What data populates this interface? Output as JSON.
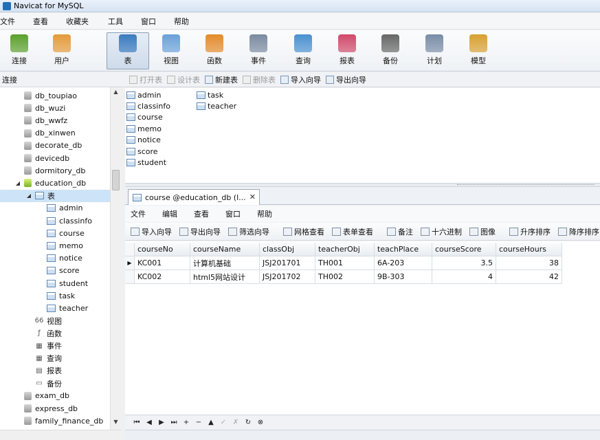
{
  "window": {
    "title": "Navicat for MySQL"
  },
  "menu": [
    "文件",
    "查看",
    "收藏夹",
    "工具",
    "窗口",
    "帮助"
  ],
  "toolbar": [
    {
      "label": "连接",
      "icon": "connection-icon",
      "color": "#5aa02c"
    },
    {
      "label": "用户",
      "icon": "user-icon",
      "color": "#e49a3a"
    },
    {
      "label": "表",
      "icon": "table-icon",
      "color": "#3b7bbf",
      "active": true
    },
    {
      "label": "视图",
      "icon": "view-icon",
      "color": "#6aa0d8"
    },
    {
      "label": "函数",
      "icon": "function-icon",
      "color": "#e48a2a"
    },
    {
      "label": "事件",
      "icon": "event-icon",
      "color": "#7a8aa0"
    },
    {
      "label": "查询",
      "icon": "query-icon",
      "color": "#4a90d0"
    },
    {
      "label": "报表",
      "icon": "report-icon",
      "color": "#d04a6a"
    },
    {
      "label": "备份",
      "icon": "backup-icon",
      "color": "#666666"
    },
    {
      "label": "计划",
      "icon": "schedule-icon",
      "color": "#7a8ca6"
    },
    {
      "label": "模型",
      "icon": "model-icon",
      "color": "#d8a030"
    }
  ],
  "sidebar": {
    "header": "连接",
    "nodes": [
      {
        "label": "db_toupiao",
        "kind": "db"
      },
      {
        "label": "db_wuzi",
        "kind": "db"
      },
      {
        "label": "db_wwfz",
        "kind": "db"
      },
      {
        "label": "db_xinwen",
        "kind": "db"
      },
      {
        "label": "decorate_db",
        "kind": "db"
      },
      {
        "label": "devicedb",
        "kind": "db"
      },
      {
        "label": "dormitory_db",
        "kind": "db"
      },
      {
        "label": "education_db",
        "kind": "db-open"
      },
      {
        "label": "表",
        "kind": "tables-folder"
      },
      {
        "label": "admin",
        "kind": "table"
      },
      {
        "label": "classinfo",
        "kind": "table"
      },
      {
        "label": "course",
        "kind": "table"
      },
      {
        "label": "memo",
        "kind": "table"
      },
      {
        "label": "notice",
        "kind": "table"
      },
      {
        "label": "score",
        "kind": "table"
      },
      {
        "label": "student",
        "kind": "table"
      },
      {
        "label": "task",
        "kind": "table"
      },
      {
        "label": "teacher",
        "kind": "table"
      },
      {
        "label": "视图",
        "kind": "view"
      },
      {
        "label": "函数",
        "kind": "function"
      },
      {
        "label": "事件",
        "kind": "event"
      },
      {
        "label": "查询",
        "kind": "query"
      },
      {
        "label": "报表",
        "kind": "report"
      },
      {
        "label": "备份",
        "kind": "backup"
      },
      {
        "label": "exam_db",
        "kind": "db"
      },
      {
        "label": "express_db",
        "kind": "db"
      },
      {
        "label": "family_finance_db",
        "kind": "db"
      }
    ]
  },
  "object_toolbar": [
    {
      "label": "打开表",
      "enabled": false
    },
    {
      "label": "设计表",
      "enabled": false
    },
    {
      "label": "新建表",
      "enabled": true
    },
    {
      "label": "删除表",
      "enabled": false
    },
    {
      "label": "导入向导",
      "enabled": true
    },
    {
      "label": "导出向导",
      "enabled": true
    }
  ],
  "object_list": {
    "col1": [
      "admin",
      "classinfo",
      "course",
      "memo",
      "notice",
      "score",
      "student"
    ],
    "col2": [
      "task",
      "teacher"
    ]
  },
  "tab": {
    "label": "course @education_db (l...",
    "close": "✕"
  },
  "inner_menu": [
    "文件",
    "编辑",
    "查看",
    "窗口",
    "帮助"
  ],
  "inner_toolbar": [
    {
      "label": "导入向导"
    },
    {
      "label": "导出向导"
    },
    {
      "label": "筛选向导"
    },
    {
      "label": "网格查看",
      "sep_before": true
    },
    {
      "label": "表单查看"
    },
    {
      "label": "备注",
      "sep_before": true
    },
    {
      "label": "十六进制"
    },
    {
      "label": "图像"
    },
    {
      "label": "升序排序",
      "sep_before": true
    },
    {
      "label": "降序排序"
    }
  ],
  "grid": {
    "columns": [
      "courseNo",
      "courseName",
      "classObj",
      "teacherObj",
      "teachPlace",
      "courseScore",
      "courseHours"
    ],
    "rows": [
      [
        "KC001",
        "计算机基础",
        "JSJ201701",
        "TH001",
        "6A-203",
        "3.5",
        "38"
      ],
      [
        "KC002",
        "html5网站设计",
        "JSJ201702",
        "TH002",
        "9B-303",
        "4",
        "42"
      ]
    ]
  },
  "navigator": [
    "⏮",
    "◀",
    "▶",
    "⏭",
    "+",
    "−",
    "▲",
    "✓",
    "✗",
    "↻",
    "⊗"
  ]
}
